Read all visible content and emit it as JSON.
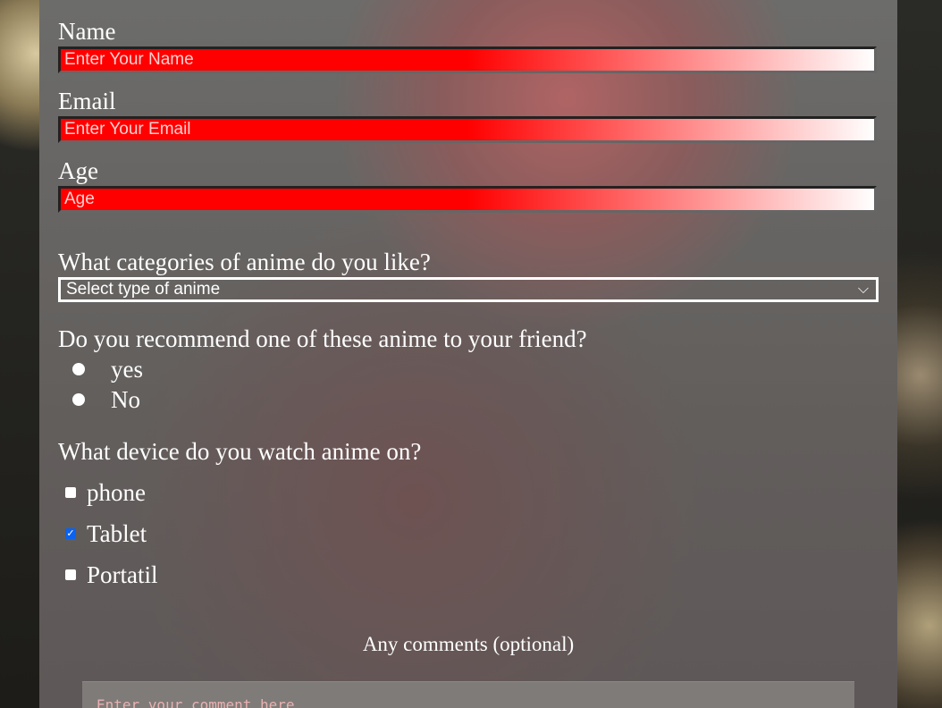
{
  "form": {
    "name_label": "Name",
    "name_placeholder": "Enter Your Name",
    "email_label": "Email",
    "email_placeholder": "Enter Your Email",
    "age_label": "Age",
    "age_placeholder": "Age",
    "category_question": "What categories of anime do you like?",
    "category_selected": "Select type of anime",
    "recommend_question": "Do you recommend one of these anime to your friend?",
    "recommend_options": [
      "yes",
      "No"
    ],
    "device_question": "What device do you watch anime on?",
    "devices": [
      {
        "label": "phone",
        "checked": false
      },
      {
        "label": "Tablet",
        "checked": true
      },
      {
        "label": "Portatil",
        "checked": false
      }
    ],
    "comments_label": "Any comments (optional)",
    "comments_placeholder": "Enter your comment here"
  },
  "colors": {
    "input_gradient_start": "#ff0000",
    "input_gradient_end": "#ffffff",
    "checkbox_accent": "#0a62f0"
  }
}
